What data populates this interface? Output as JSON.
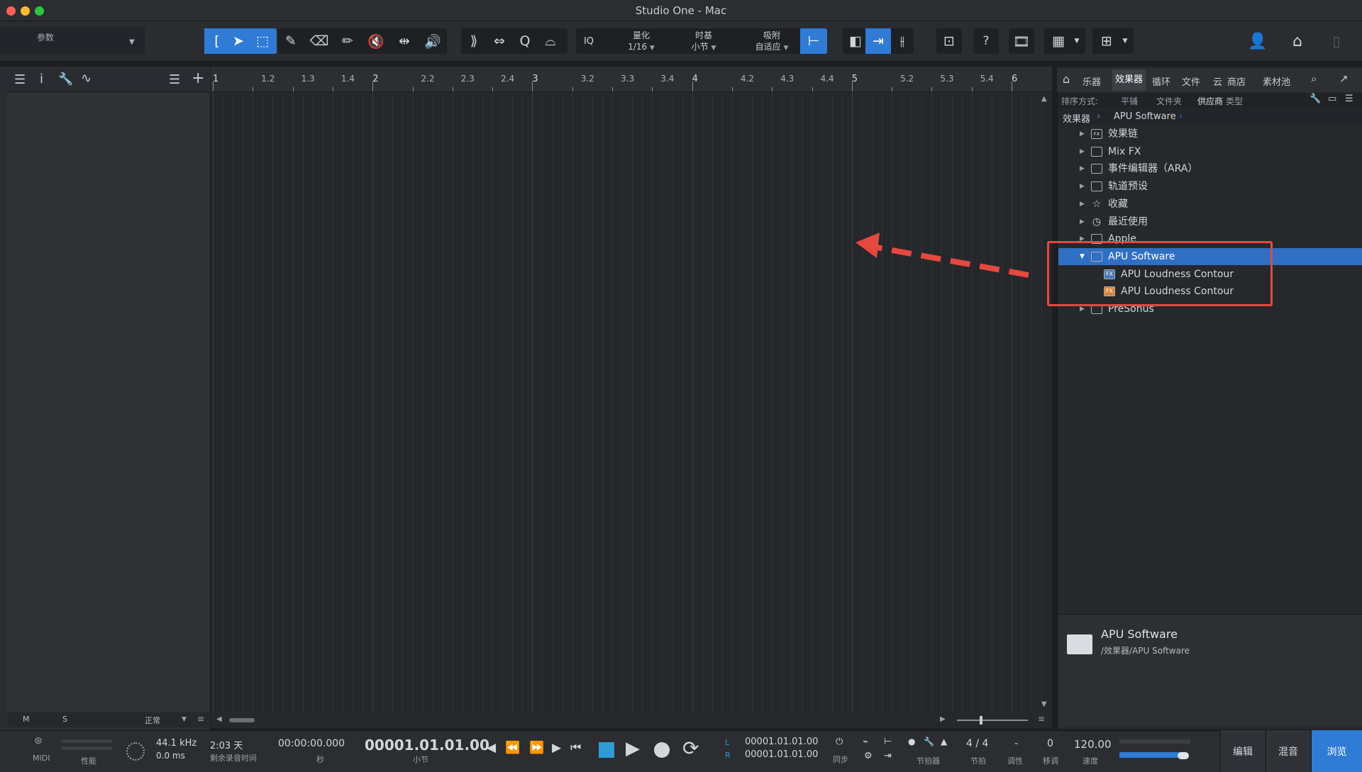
{
  "window": {
    "title": "Studio One - Mac"
  },
  "params": {
    "label": "参数"
  },
  "toolbar": {
    "iq": "IQ",
    "quantize": {
      "label": "量化",
      "value": "1/16"
    },
    "timebase": {
      "label": "时基",
      "value": "小节"
    },
    "snap": {
      "label": "吸附",
      "value": "自适应"
    },
    "help": "?"
  },
  "left_panel": {
    "info_icon": "i",
    "footer": {
      "m": "M",
      "s": "S",
      "mode": "正常"
    }
  },
  "ruler": {
    "labels": [
      "1",
      "1.2",
      "1.3",
      "1.4",
      "2",
      "2.2",
      "2.3",
      "2.4",
      "3",
      "3.2",
      "3.3",
      "3.4",
      "4",
      "4.2",
      "4.3",
      "4.4",
      "5",
      "5.2",
      "5.3",
      "5.4",
      "6"
    ]
  },
  "browser": {
    "tabs": [
      "乐器",
      "效果器",
      "循环",
      "文件",
      "云",
      "商店",
      "素材池"
    ],
    "active_tab": "效果器",
    "sort": {
      "label": "排序方式:",
      "options": [
        "平铺",
        "文件夹",
        "供应商",
        "类型"
      ],
      "active": "供应商"
    },
    "breadcrumb": {
      "root": "效果器",
      "current": "APU Software"
    },
    "tree": [
      {
        "label": "效果链",
        "icon": "fx-chain-icon"
      },
      {
        "label": "Mix FX",
        "icon": "folder-icon"
      },
      {
        "label": "事件编辑器（ARA）",
        "icon": "folder-icon"
      },
      {
        "label": "轨道预设",
        "icon": "folder-icon"
      },
      {
        "label": "收藏",
        "icon": "star-icon"
      },
      {
        "label": "最近使用",
        "icon": "clock-icon"
      },
      {
        "label": "Apple",
        "icon": "folder-icon"
      },
      {
        "label": "APU Software",
        "icon": "folder-open-icon",
        "selected": true
      },
      {
        "label": "APU Loudness Contour",
        "icon": "fx-vst-icon",
        "child": true
      },
      {
        "label": "APU Loudness Contour",
        "icon": "fx-au-icon",
        "child": true
      },
      {
        "label": "PreSonus",
        "icon": "folder-icon"
      }
    ],
    "info": {
      "name": "APU Software",
      "path": "/效果器/APU Software"
    }
  },
  "transport": {
    "midi": "MIDI",
    "performance": "性能",
    "sample_rate": "44.1 kHz",
    "latency": "0.0 ms",
    "record_time": "2:03 天",
    "record_time_label": "剩余录音时间",
    "time_seconds": "00:00:00.000",
    "time_seconds_unit": "秒",
    "time_bars": "00001.01.01.00",
    "time_bars_unit": "小节",
    "loop_l": "00001.01.01.00",
    "loop_r": "00001.01.01.00",
    "l": "L",
    "r": "R",
    "sync": "同步",
    "metronome": "节拍器",
    "signature": "4 / 4",
    "signature_label": "节拍",
    "key": "-",
    "key_label": "调性",
    "transpose": "0",
    "transpose_label": "移调",
    "tempo": "120.00",
    "tempo_label": "速度"
  },
  "modes": {
    "edit": "编辑",
    "mix": "混音",
    "browse": "浏览"
  },
  "colors": {
    "accent": "#2f7bd6",
    "annotation": "#e5483f",
    "selection": "#2f6fc4"
  }
}
